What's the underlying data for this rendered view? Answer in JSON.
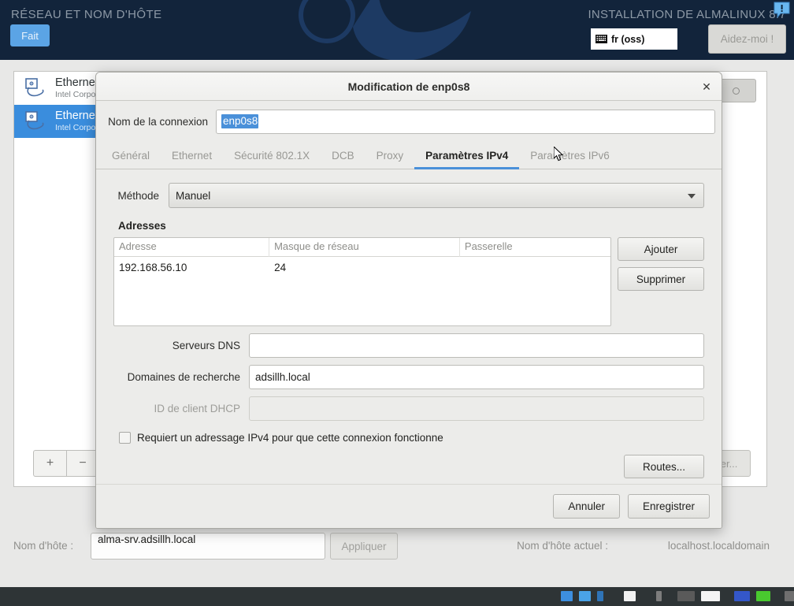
{
  "header": {
    "section_title": "RÉSEAU ET NOM D'HÔTE",
    "done_label": "Fait",
    "install_title": "INSTALLATION DE ALMALINUX 8.7",
    "keyboard_layout": "fr (oss)",
    "keyboard_icon": "keyboard-icon",
    "help_label": "Aidez-moi !",
    "warning_icon": "warning-bubble-icon",
    "bg_color": "#12243b",
    "accent_color": "#5ba4e5"
  },
  "network_page": {
    "devices": [
      {
        "name": "Ethernet",
        "vendor": "Intel Corpora",
        "icon": "ethernet-icon",
        "selected": false
      },
      {
        "name": "Ethernet",
        "vendor": "Intel Corpora",
        "icon": "ethernet-icon",
        "selected": true
      }
    ],
    "add_label": "+",
    "remove_label": "−",
    "configure_label": "Configurer...",
    "toggle_state": "off",
    "hostname_label": "Nom d'hôte :",
    "hostname_value": "alma-srv.adsillh.local",
    "apply_label": "Appliquer",
    "current_hostname_label": "Nom d'hôte actuel :",
    "current_hostname_value": "localhost.localdomain"
  },
  "dialog": {
    "title": "Modification de enp0s8",
    "close_label": "✕",
    "connection_name_label": "Nom de la connexion",
    "connection_name_value": "enp0s8",
    "connection_name_selected": true,
    "tabs": [
      {
        "label": "Général",
        "active": false
      },
      {
        "label": "Ethernet",
        "active": false
      },
      {
        "label": "Sécurité 802.1X",
        "active": false
      },
      {
        "label": "DCB",
        "active": false
      },
      {
        "label": "Proxy",
        "active": false
      },
      {
        "label": "Paramètres IPv4",
        "active": true
      },
      {
        "label": "Paramètres IPv6",
        "active": false
      }
    ],
    "ipv4": {
      "method_label": "Méthode",
      "method_value": "Manuel",
      "addresses_title": "Adresses",
      "columns": [
        "Adresse",
        "Masque de réseau",
        "Passerelle"
      ],
      "rows": [
        {
          "address": "192.168.56.10",
          "netmask": "24",
          "gateway": ""
        }
      ],
      "add_button": "Ajouter",
      "delete_button": "Supprimer",
      "dns_label": "Serveurs DNS",
      "dns_value": "",
      "search_domains_label": "Domaines de recherche",
      "search_domains_value": "adsillh.local",
      "dhcp_client_id_label": "ID de client DHCP",
      "dhcp_client_id_value": "",
      "dhcp_client_id_disabled": true,
      "require_ipv4_label": "Requiert un adressage IPv4 pour que cette connexion fonctionne",
      "require_ipv4_checked": false,
      "routes_button": "Routes..."
    },
    "cancel_label": "Annuler",
    "save_label": "Enregistrer",
    "accent_color": "#4a90d9"
  }
}
